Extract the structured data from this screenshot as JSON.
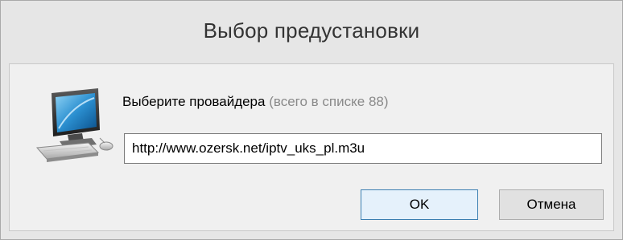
{
  "dialog": {
    "title": "Выбор предустановки",
    "prompt_label": "Выберите провайдера",
    "prompt_count": "(всего в списке 88)",
    "url_value": "http://www.ozersk.net/iptv_uks_pl.m3u",
    "ok_label": "OK",
    "cancel_label": "Отмена",
    "icon": "computer-icon"
  },
  "colors": {
    "window_bg": "#e6e6e6",
    "client_bg": "#f0f0f0",
    "ok_border": "#3c7fb1",
    "ok_bg": "#e5f1fb",
    "count_text": "#8a8a8a"
  }
}
